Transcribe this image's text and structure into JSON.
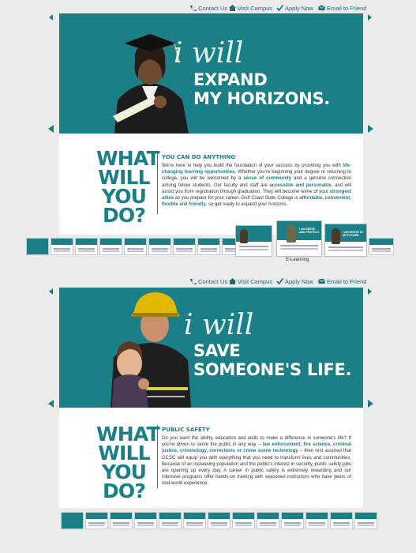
{
  "nav": {
    "contact": "Contact Us",
    "visit": "Visit Campus",
    "apply": "Apply Now",
    "email": "Email to Friend"
  },
  "panel1": {
    "iwill": "i will",
    "headline1": "EXPAND",
    "headline2": "MY HORIZONS.",
    "wwyd1": "WHAT",
    "wwyd2": "WILL",
    "wwyd3": "YOU DO?",
    "section_title": "YOU CAN DO ANYTHING",
    "body": {
      "t1": "We're here to help you build the foundation of your success by providing you with ",
      "b1": "life-changing learning opportunities",
      "t2": ". Whether you're beginning your degree or returning to college, you will be welcomed by a ",
      "b2": "sense of community",
      "t3": " and a genuine connection among fellow students. Our faculty and staff are ",
      "b3": "accessible and personable",
      "t4": ", and will assist you from registration through graduation. They will become some of your ",
      "b4": "strongest allies",
      "t5": " as you prepare for your career. Gulf Coast State College is ",
      "b5": "affordable, convenient, flexible",
      "t6": " and ",
      "b6": "friendly",
      "t7": ", so get ready to expand your horizons."
    },
    "selected_caption": "E-Learning"
  },
  "panel2": {
    "iwill": "i will",
    "headline1": "SAVE",
    "headline2": "SOMEONE'S LIFE.",
    "wwyd1": "WHAT",
    "wwyd2": "WILL",
    "wwyd3": "YOU DO?",
    "section_title": "PUBLIC SAFETY",
    "body": {
      "t1": "Do you want the ability, education and skills to make a difference in someone's life? If you're driven to serve the public in any way – ",
      "b1": "law enforcement, fire science, criminal justice, criminology, corrections or crime scene technology",
      "t2": " – then rest assured that GCSC will equip you with everything that you need to transform lives and communities. Because of an increasing population and the public's interest in security, public safety jobs are opening up every day. A career in public safety is extremely rewarding and our intensive programs offer hands-on training with seasoned instructors who have years of real-world experience."
    }
  },
  "thumbs": {
    "a": "i will SERVE AND PROTECT.",
    "b": "i will INVEST IN MY FUTURE."
  }
}
